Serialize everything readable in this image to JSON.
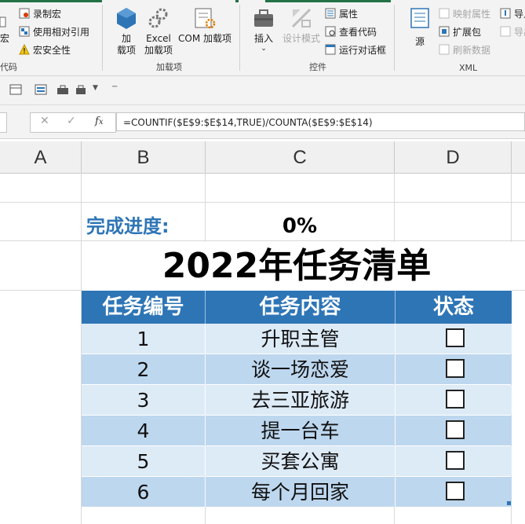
{
  "ribbon": {
    "code_group": {
      "label": "代码",
      "partial_macro": "宏",
      "record_macro": "录制宏",
      "relative_ref": "使用相对引用",
      "macro_security": "宏安全性"
    },
    "addins_group": {
      "label": "加载项",
      "addins_line1": "加",
      "addins_line2": "载项",
      "excel_line1": "Excel",
      "excel_line2": "加载项",
      "com_addins": "COM 加载项"
    },
    "controls_group": {
      "label": "控件",
      "insert": "插入",
      "design_mode": "设计模式",
      "properties": "属性",
      "view_code": "查看代码",
      "run_dialog": "运行对话框"
    },
    "xml_group": {
      "label": "XML",
      "source": "源",
      "map_properties": "映射属性",
      "expansion_packs": "扩展包",
      "refresh_data": "刷新数据",
      "import_partial": "导入",
      "export_partial": "导出"
    }
  },
  "formula_bar": {
    "formula": "=COUNTIF($E$9:$E$14,TRUE)/COUNTA($E$9:$E$14)"
  },
  "columns": [
    "A",
    "B",
    "C",
    "D"
  ],
  "sheet": {
    "progress_label": "完成进度:",
    "progress_value": "0%",
    "title": "2022年任务清单",
    "headers": [
      "任务编号",
      "任务内容",
      "状态"
    ],
    "rows": [
      {
        "num": "1",
        "task": "升职主管"
      },
      {
        "num": "2",
        "task": "谈一场恋爱"
      },
      {
        "num": "3",
        "task": "去三亚旅游"
      },
      {
        "num": "4",
        "task": "提一台车"
      },
      {
        "num": "5",
        "task": "买套公寓"
      },
      {
        "num": "6",
        "task": "每个月回家"
      }
    ]
  },
  "colors": {
    "accent": "#217346",
    "header_blue": "#2e75b6",
    "row_light": "#ddebf7",
    "row_dark": "#bdd7ee"
  }
}
